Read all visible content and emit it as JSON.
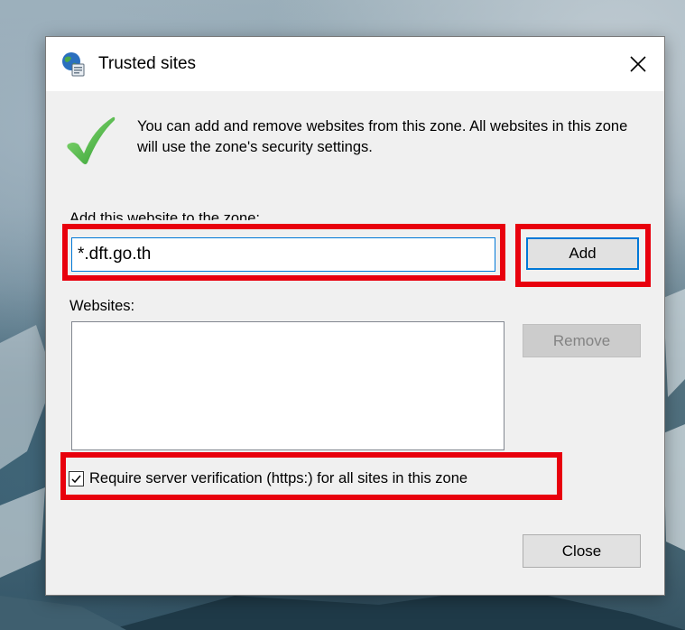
{
  "dialog": {
    "title": "Trusted sites",
    "title_icon": "globe-trusted-icon",
    "close_icon": "close-icon"
  },
  "info": {
    "icon": "check-icon",
    "text": "You can add and remove websites from this zone. All websites in this zone will use the zone's security settings."
  },
  "add_section": {
    "label": "Add this website to the zone:",
    "input_value": "*.dft.go.th",
    "add_button": "Add"
  },
  "websites": {
    "label": "Websites:",
    "items": [],
    "remove_button": "Remove"
  },
  "verification": {
    "checked": true,
    "label": "Require server verification (https:) for all sites in this zone"
  },
  "footer": {
    "close_button": "Close"
  },
  "colors": {
    "highlight": "#e8000d",
    "focus_border": "#0078d7",
    "dialog_bg": "#f0f0f0"
  }
}
